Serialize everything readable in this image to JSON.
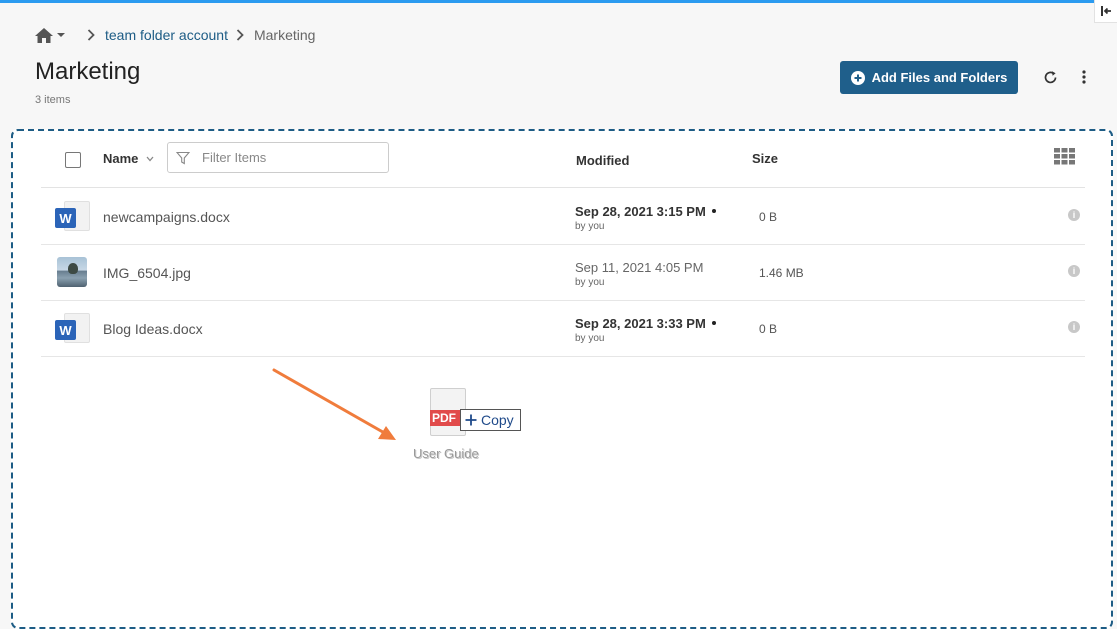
{
  "breadcrumb": {
    "home_icon": "home-icon",
    "items": [
      "team folder account",
      "Marketing"
    ]
  },
  "page": {
    "title": "Marketing",
    "item_count": "3 items"
  },
  "toolbar": {
    "add_label": "Add Files and Folders",
    "refresh_icon": "refresh-icon",
    "more_icon": "more-vertical-icon",
    "accent": "#1f5f8b"
  },
  "table": {
    "headers": {
      "name": "Name",
      "filter_placeholder": "Filter Items",
      "modified": "Modified",
      "size": "Size"
    },
    "rows": [
      {
        "name": "newcampaigns.docx",
        "modified": "Sep 28, 2021 3:15 PM",
        "by": "by you",
        "size": "0 B",
        "type": "word",
        "unread": true
      },
      {
        "name": "IMG_6504.jpg",
        "modified": "Sep 11, 2021 4:05 PM",
        "by": "by you",
        "size": "1.46 MB",
        "type": "image",
        "unread": false
      },
      {
        "name": "Blog Ideas.docx",
        "modified": "Sep 28, 2021 3:33 PM",
        "by": "by you",
        "size": "0 B",
        "type": "word",
        "unread": true
      }
    ]
  },
  "drag": {
    "file_type": "PDF",
    "tooltip": "Copy",
    "file_label": "User Guide",
    "arrow_color": "#f07c3c"
  },
  "colors": {
    "link": "#1d5c85",
    "dropzone_border": "#1d5c85",
    "top_bar": "#2b9bf0",
    "word_badge": "#2b64b8",
    "pdf_badge": "#e14b4b"
  }
}
